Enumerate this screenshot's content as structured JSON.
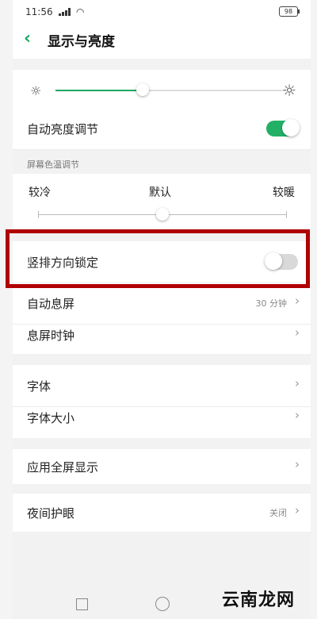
{
  "status_bar": {
    "time": "11:56",
    "wifi_icon": "wifi-icon",
    "battery": "98"
  },
  "header": {
    "back_icon": "chevron-left-icon",
    "title": "显示与亮度"
  },
  "brightness": {
    "level": 0.38,
    "low_icon": "sun-small-icon",
    "high_icon": "sun-large-icon"
  },
  "auto_brightness": {
    "label": "自动亮度调节",
    "on": true
  },
  "color_temp": {
    "section_label": "屏幕色温调节",
    "cool": "较冷",
    "default": "默认",
    "warm": "较暖",
    "level": 0.5
  },
  "rows": {
    "portrait_lock": {
      "label": "竖排方向锁定",
      "on": false
    },
    "auto_sleep": {
      "label": "自动息屏",
      "value": "30 分钟"
    },
    "sleep_clock": {
      "label": "息屏时钟"
    },
    "font": {
      "label": "字体"
    },
    "font_size": {
      "label": "字体大小"
    },
    "full_screen": {
      "label": "应用全屏显示"
    },
    "night_mode": {
      "label": "夜间护眼",
      "value": "关闭"
    }
  },
  "chevron": "›",
  "watermark": "云南龙网",
  "colors": {
    "accent": "#22b067",
    "highlight_border": "#b00000"
  }
}
